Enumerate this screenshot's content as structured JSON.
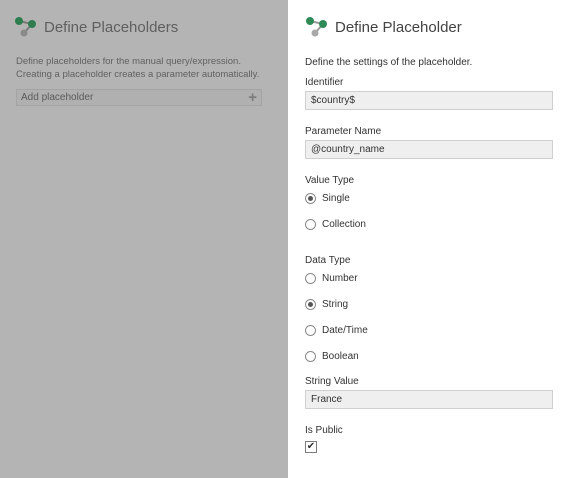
{
  "left_panel": {
    "title": "Define Placeholders",
    "description_line1": "Define placeholders for the manual query/expression.",
    "description_line2": "Creating a placeholder creates a parameter automatically.",
    "add_placeholder_label": "Add placeholder",
    "add_icon": "plus-icon"
  },
  "dialog": {
    "title": "Define Placeholder",
    "description": "Define the settings of the placeholder.",
    "identifier": {
      "label": "Identifier",
      "value": "$country$"
    },
    "parameter_name": {
      "label": "Parameter Name",
      "value": "@country_name"
    },
    "value_type": {
      "label": "Value Type",
      "options": [
        "Single",
        "Collection"
      ],
      "selected": "Single"
    },
    "data_type": {
      "label": "Data Type",
      "options": [
        "Number",
        "String",
        "Date/Time",
        "Boolean"
      ],
      "selected": "String"
    },
    "string_value": {
      "label": "String Value",
      "value": "France"
    },
    "is_public": {
      "label": "Is Public",
      "checked": true
    }
  },
  "colors": {
    "logo_green": "#2e8b57",
    "logo_gray": "#7a7a7a",
    "overlay": "#b4b4b4"
  }
}
